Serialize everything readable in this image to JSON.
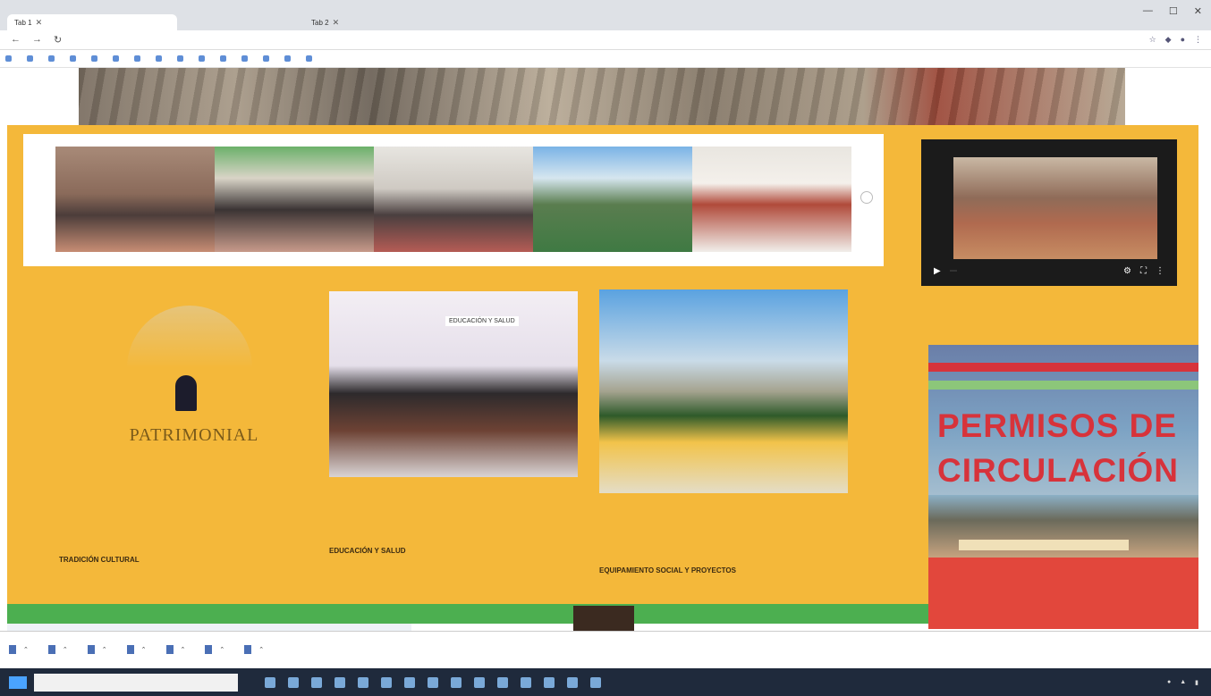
{
  "browser": {
    "tabs": [
      {
        "label": "Tab 1"
      },
      {
        "label": "Tab 2"
      }
    ],
    "url": "",
    "bookmarks": [
      "",
      "",
      "",
      "",
      "",
      "",
      "",
      "",
      "",
      "",
      "",
      "",
      "",
      "",
      ""
    ]
  },
  "page": {
    "slider": {
      "slides": [
        "s1",
        "s2",
        "s3",
        "s4",
        "s5"
      ]
    },
    "video": {
      "time": ""
    },
    "logo": {
      "subtitle": "",
      "title": "PATRIMONIAL"
    },
    "cards": [
      {
        "title": "TRADICIÓN CULTURAL",
        "desc": ""
      },
      {
        "title": "EDUCACIÓN Y SALUD",
        "badge": "EDUCACIÓN Y SALUD",
        "desc": ""
      },
      {
        "title": "EQUIPAMIENTO SOCIAL Y PROYECTOS",
        "desc": ""
      }
    ],
    "permisos": {
      "line1": "PERMISOS DE",
      "line2": "CIRCULACIÓN"
    }
  },
  "downloads": {
    "items": [
      "",
      "",
      "",
      "",
      "",
      "",
      ""
    ],
    "show_all": ""
  },
  "taskbar": {
    "search_placeholder": ""
  }
}
